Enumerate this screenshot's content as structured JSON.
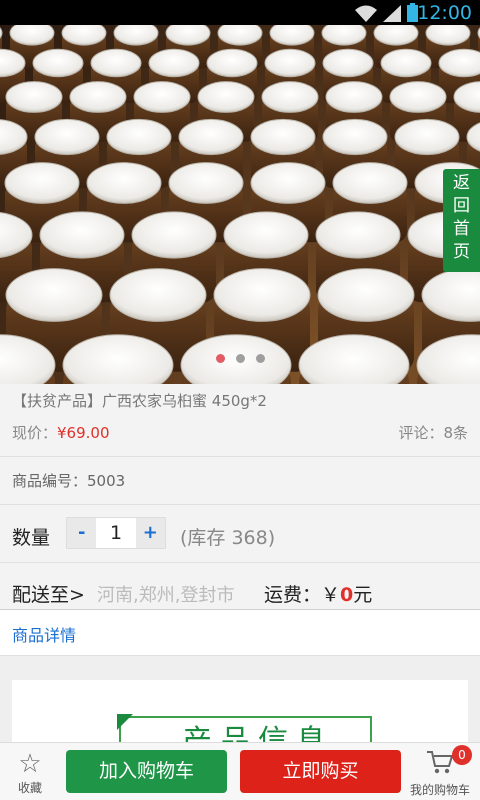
{
  "status_bar": {
    "time": "12:00"
  },
  "product": {
    "title": "【扶贫产品】广西农家乌桕蜜 450g*2",
    "price_label": "现价：",
    "price": "¥69.00",
    "reviews": "评论：8条",
    "sku": "商品编号：5003",
    "quantity_label": "数量",
    "quantity": "1",
    "minus": "-",
    "plus": "+",
    "stock": "(库存 368)",
    "ship_label": "配送至>",
    "ship_location": "河南,郑州,登封市",
    "fee_label": "运费：￥",
    "fee_value": "0",
    "fee_unit": "元"
  },
  "back_home": [
    "返",
    "回",
    "首",
    "页"
  ],
  "carousel": {
    "total": 3,
    "active": 1
  },
  "details_tab": "商品详情",
  "banner_text": "产品信息",
  "bottom": {
    "favorite": "收藏",
    "add_to_cart": "加入购物车",
    "buy_now": "立即购买",
    "my_cart": "我的购物车",
    "cart_count": "0"
  },
  "colors": {
    "green": "#1f9548",
    "red": "#dc2219",
    "link": "#1a6fd1",
    "price": "#e0302a"
  }
}
